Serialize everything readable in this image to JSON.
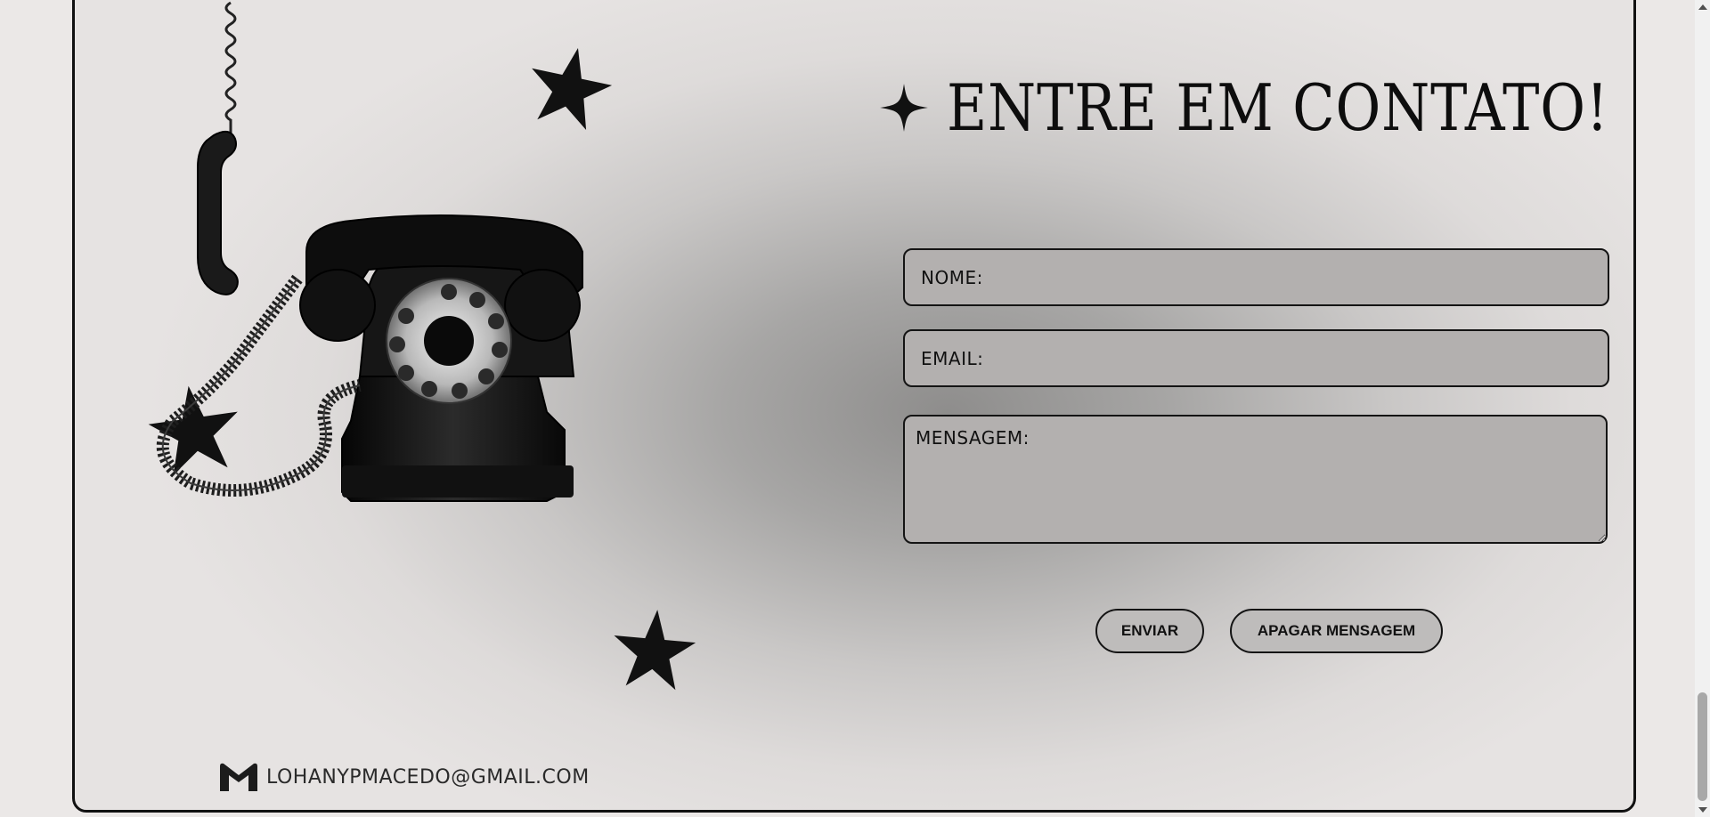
{
  "contact": {
    "title": "ENTRE EM CONTATO!",
    "form": {
      "name_placeholder": "NOME:",
      "email_placeholder": "EMAIL:",
      "message_placeholder": "MENSAGEM:",
      "send_label": "ENVIAR",
      "clear_label": "APAGAR MENSAGEM"
    },
    "footer_email": "LOHANYPMACEDO@GMAIL.COM"
  },
  "icons": {
    "title": "sparkle-icon",
    "email": "gmail-icon",
    "decor": [
      "star-icon",
      "star-icon",
      "star-icon"
    ],
    "illustration": "rotary-telephone-illustration"
  },
  "colors": {
    "ink": "#111111",
    "field_bg": "#b3b0af",
    "button_bg": "#bebcbb",
    "page_bg": "#ebe8e7"
  }
}
